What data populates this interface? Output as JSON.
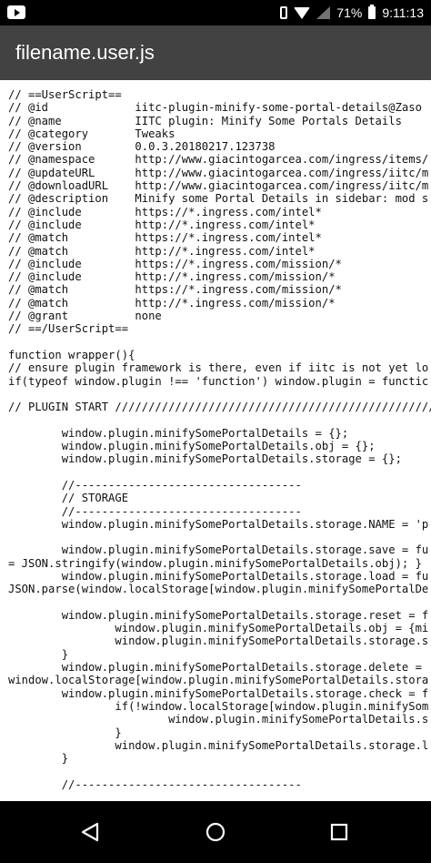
{
  "status_bar": {
    "battery": "71%",
    "time": "9:11:13",
    "icons": [
      "youtube-icon",
      "vibrate-icon",
      "wifi-icon",
      "signal-icon",
      "battery-icon"
    ]
  },
  "app_bar": {
    "title": "filename.user.js"
  },
  "code": [
    "// ==UserScript==",
    "// @id             iitc-plugin-minify-some-portal-details@Zaso",
    "// @name           IITC plugin: Minify Some Portals Details",
    "// @category       Tweaks",
    "// @version        0.0.3.20180217.123738",
    "// @namespace      http://www.giacintogarcea.com/ingress/items/",
    "// @updateURL      http://www.giacintogarcea.com/ingress/iitc/m",
    "// @downloadURL    http://www.giacintogarcea.com/ingress/iitc/m",
    "// @description    Minify some Portal Details in sidebar: mod s",
    "// @include        https://*.ingress.com/intel*",
    "// @include        http://*.ingress.com/intel*",
    "// @match          https://*.ingress.com/intel*",
    "// @match          http://*.ingress.com/intel*",
    "// @include        https://*.ingress.com/mission/*",
    "// @include        http://*.ingress.com/mission/*",
    "// @match          https://*.ingress.com/mission/*",
    "// @match          http://*.ingress.com/mission/*",
    "// @grant          none",
    "// ==/UserScript==",
    "",
    "function wrapper(){",
    "// ensure plugin framework is there, even if iitc is not yet lo",
    "if(typeof window.plugin !== 'function') window.plugin = functic",
    "",
    "// PLUGIN START ///////////////////////////////////////////////////",
    "",
    "        window.plugin.minifySomePortalDetails = {};",
    "        window.plugin.minifySomePortalDetails.obj = {};",
    "        window.plugin.minifySomePortalDetails.storage = {};",
    "",
    "        //----------------------------------",
    "        // STORAGE",
    "        //----------------------------------",
    "        window.plugin.minifySomePortalDetails.storage.NAME = 'p",
    "",
    "        window.plugin.minifySomePortalDetails.storage.save = fu",
    "= JSON.stringify(window.plugin.minifySomePortalDetails.obj); }",
    "        window.plugin.minifySomePortalDetails.storage.load = fu",
    "JSON.parse(window.localStorage[window.plugin.minifySomePortalDe",
    "",
    "        window.plugin.minifySomePortalDetails.storage.reset = f",
    "                window.plugin.minifySomePortalDetails.obj = {mi",
    "                window.plugin.minifySomePortalDetails.storage.s",
    "        }",
    "        window.plugin.minifySomePortalDetails.storage.delete =",
    "window.localStorage[window.plugin.minifySomePortalDetails.stora",
    "        window.plugin.minifySomePortalDetails.storage.check = f",
    "                if(!window.localStorage[window.plugin.minifySom",
    "                        window.plugin.minifySomePortalDetails.s",
    "                }",
    "                window.plugin.minifySomePortalDetails.storage.l",
    "        }",
    "",
    "        //----------------------------------"
  ],
  "nav_bar": {
    "icons": [
      "back-icon",
      "home-icon",
      "recents-icon"
    ]
  }
}
